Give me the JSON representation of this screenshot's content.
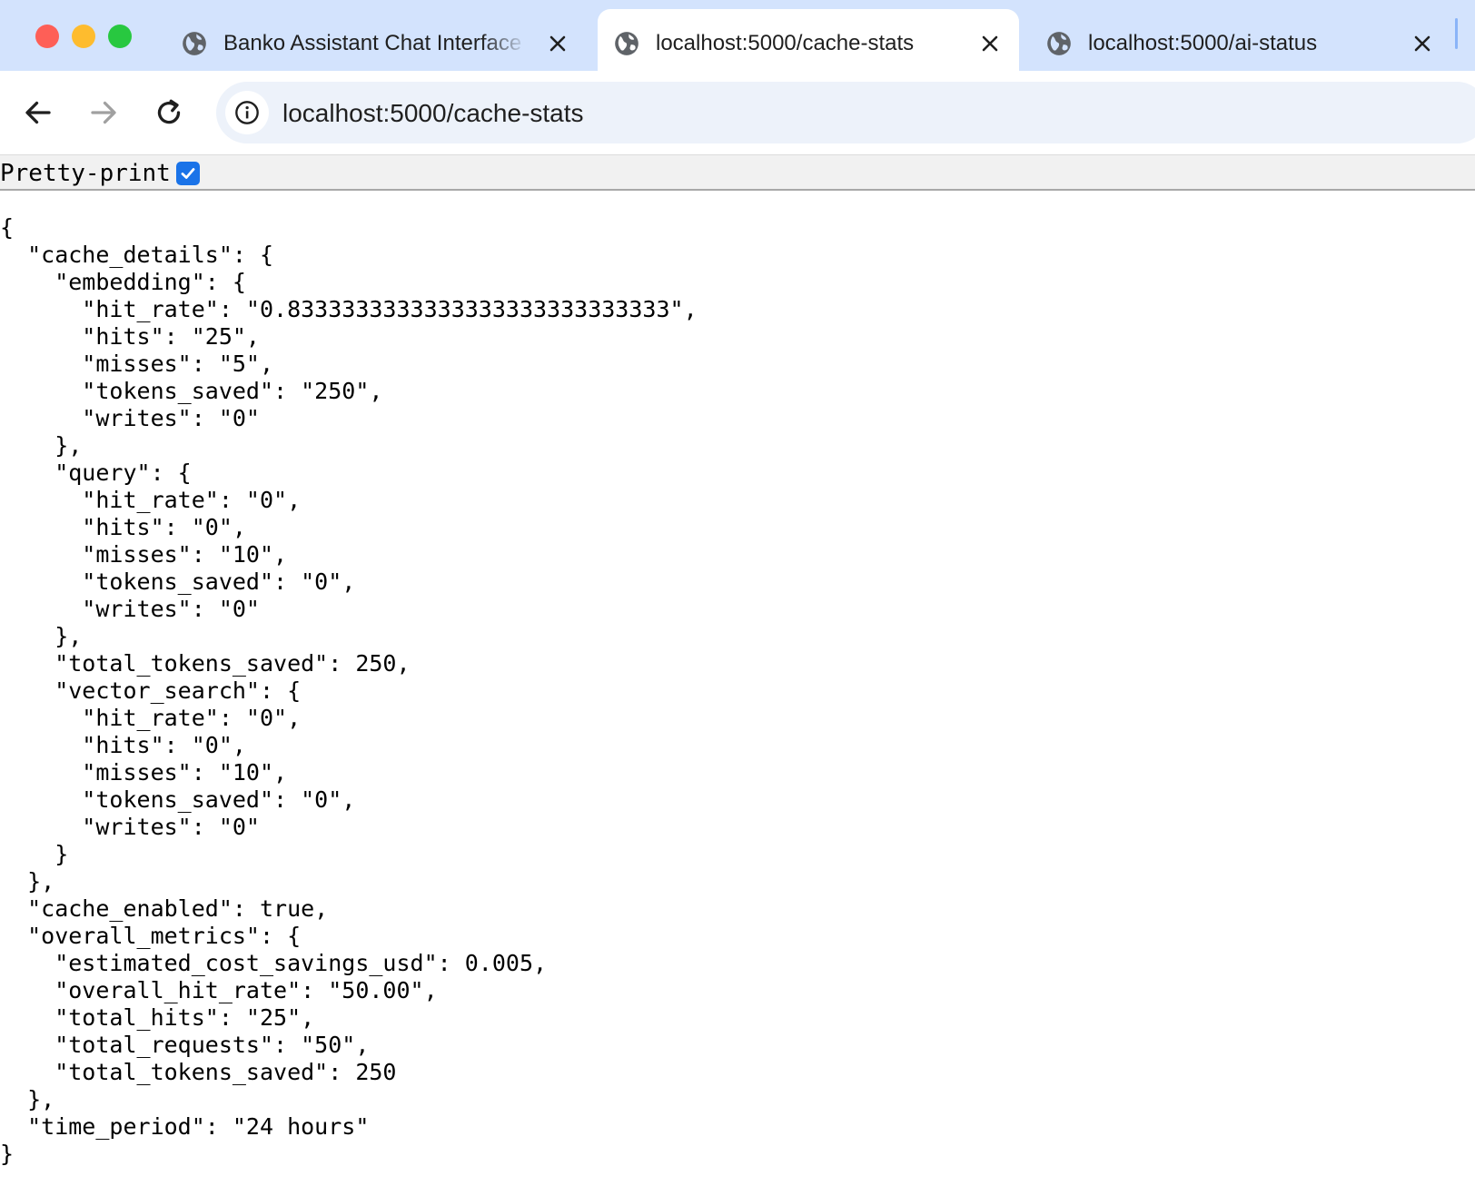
{
  "tabs": [
    {
      "title": "Banko Assistant Chat Interface",
      "active": false
    },
    {
      "title": "localhost:5000/cache-stats",
      "active": true
    },
    {
      "title": "localhost:5000/ai-status",
      "active": false
    }
  ],
  "address_bar": {
    "url": "localhost:5000/cache-stats"
  },
  "pretty_print": {
    "label": "Pretty-print",
    "checked": true
  },
  "json_lines": [
    "{",
    "  \"cache_details\": {",
    "    \"embedding\": {",
    "      \"hit_rate\": \"0.8333333333333333333333333333\",",
    "      \"hits\": \"25\",",
    "      \"misses\": \"5\",",
    "      \"tokens_saved\": \"250\",",
    "      \"writes\": \"0\"",
    "    },",
    "    \"query\": {",
    "      \"hit_rate\": \"0\",",
    "      \"hits\": \"0\",",
    "      \"misses\": \"10\",",
    "      \"tokens_saved\": \"0\",",
    "      \"writes\": \"0\"",
    "    },",
    "    \"total_tokens_saved\": 250,",
    "    \"vector_search\": {",
    "      \"hit_rate\": \"0\",",
    "      \"hits\": \"0\",",
    "      \"misses\": \"10\",",
    "      \"tokens_saved\": \"0\",",
    "      \"writes\": \"0\"",
    "    }",
    "  },",
    "  \"cache_enabled\": true,",
    "  \"overall_metrics\": {",
    "    \"estimated_cost_savings_usd\": 0.005,",
    "    \"overall_hit_rate\": \"50.00\",",
    "    \"total_hits\": \"25\",",
    "    \"total_requests\": \"50\",",
    "    \"total_tokens_saved\": 250",
    "  },",
    "  \"time_period\": \"24 hours\"",
    "}"
  ]
}
